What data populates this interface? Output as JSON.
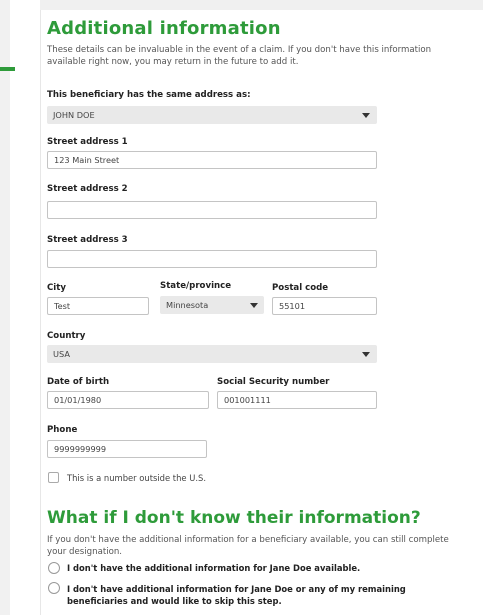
{
  "additional_info": {
    "title": "Additional information",
    "intro": "These details can be invaluable in the event of a claim. If you don't have this information available right now, you may return in the future to add it.",
    "same_address": {
      "label": "This beneficiary has the same address as:",
      "value": "JOHN DOE"
    },
    "street1": {
      "label": "Street address 1",
      "value": "123 Main Street"
    },
    "street2": {
      "label": "Street address 2",
      "value": ""
    },
    "street3": {
      "label": "Street address 3",
      "value": ""
    },
    "city": {
      "label": "City",
      "value": "Test"
    },
    "state": {
      "label": "State/province",
      "value": "Minnesota"
    },
    "postal": {
      "label": "Postal code",
      "value": "55101"
    },
    "country": {
      "label": "Country",
      "value": "USA"
    },
    "dob": {
      "label": "Date of birth",
      "value": "01/01/1980"
    },
    "ssn": {
      "label": "Social Security number",
      "value": "001001111"
    },
    "phone": {
      "label": "Phone",
      "value": "9999999999"
    },
    "outside_us_label": "This is a number outside the U.S."
  },
  "unknown_info": {
    "title": "What if I don't know their information?",
    "intro": "If you don't have the additional information for a beneficiary available, you can still complete your designation.",
    "option1": "I don't have the additional information for Jane Doe available.",
    "option2": "I don't have additional information for Jane Doe or any of my remaining beneficiaries and would like to skip this step."
  },
  "colors": {
    "accent": "#2e9b3a",
    "select_bg": "#e9e9e9",
    "border": "#c4c4c4"
  }
}
